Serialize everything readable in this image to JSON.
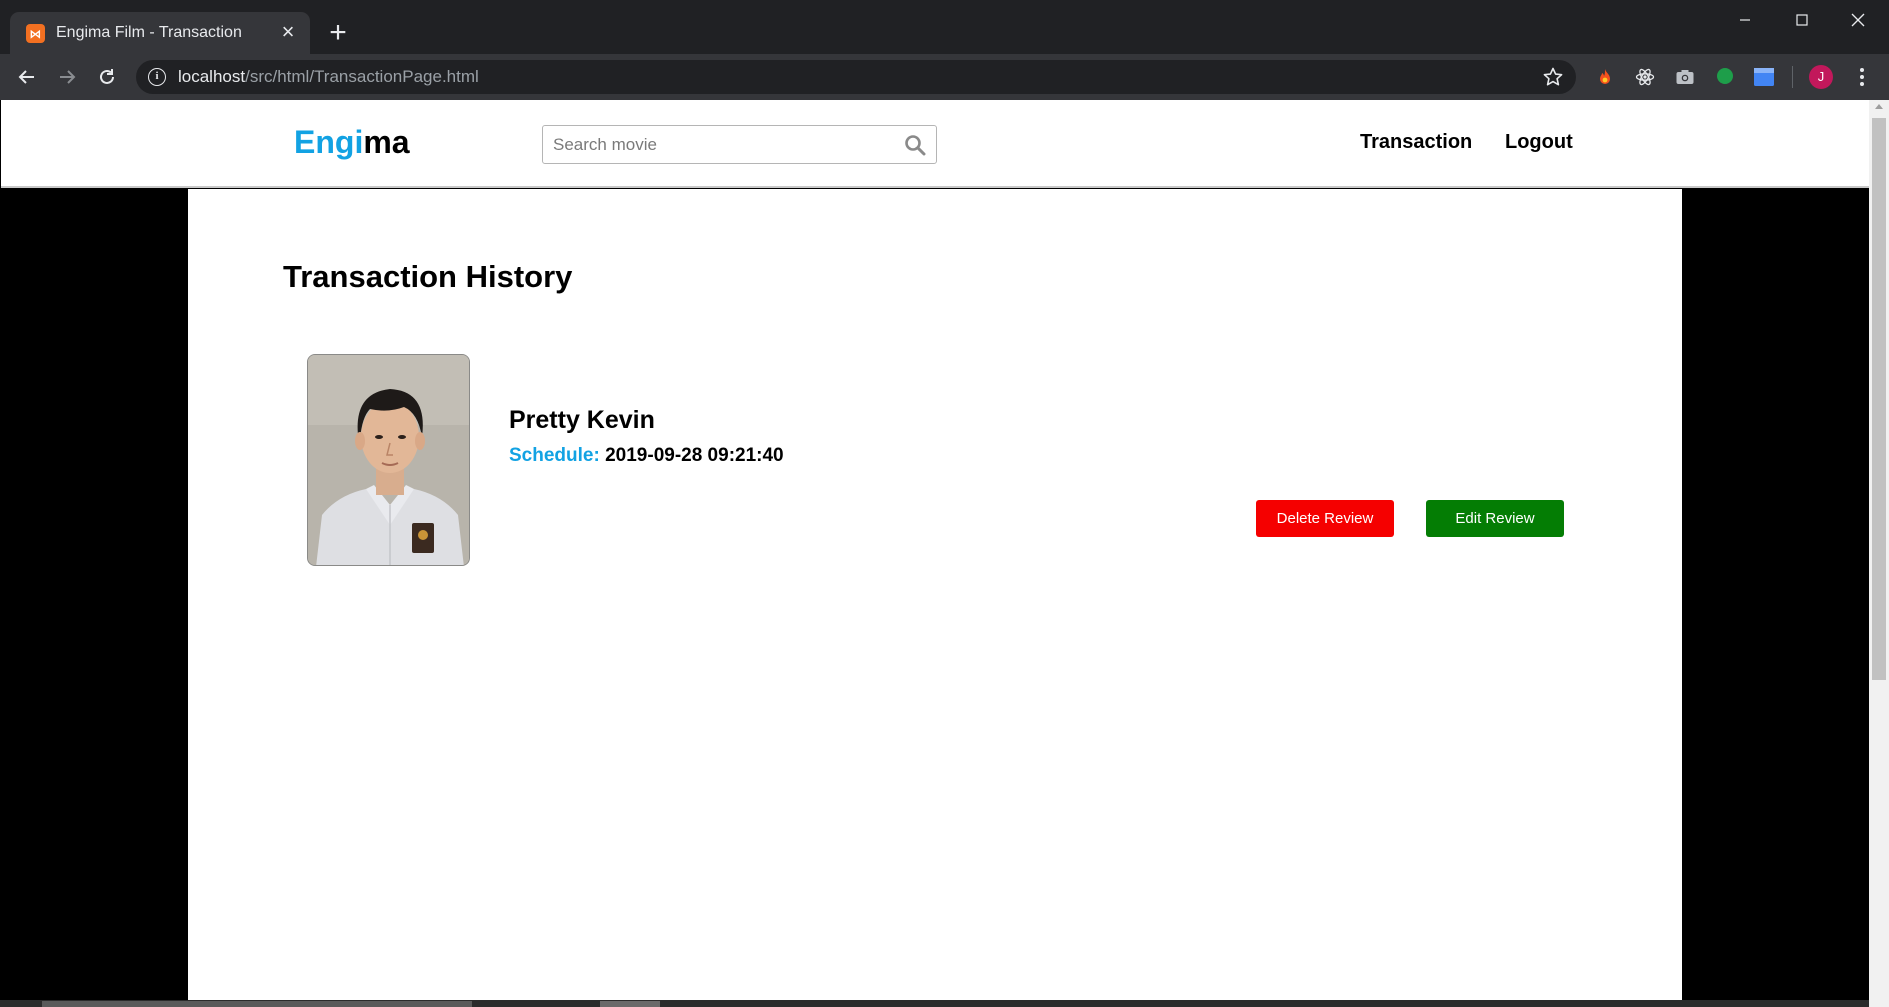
{
  "browser": {
    "tab_title": "Engima Film - Transaction",
    "tab_favicon": "xampp-favicon-icon",
    "url_host": "localhost",
    "url_path": "/src/html/TransactionPage.html",
    "profile_initial": "J",
    "extensions": [
      "fire-extension-icon",
      "react-extension-icon",
      "camera-extension-icon",
      "green-circle-extension-icon",
      "window-extension-icon"
    ]
  },
  "navbar": {
    "logo_part1": "Engi",
    "logo_part2": "ma",
    "search_placeholder": "Search movie",
    "search_value": "",
    "links": {
      "transaction": "Transaction",
      "logout": "Logout"
    }
  },
  "page": {
    "title": "Transaction History"
  },
  "transactions": [
    {
      "movie_title": "Pretty Kevin",
      "schedule_label": "Schedule:",
      "schedule_value": "2019-09-28 09:21:40",
      "delete_label": "Delete Review",
      "edit_label": "Edit Review"
    }
  ],
  "colors": {
    "accent": "#12a2e3",
    "delete": "#f50000",
    "edit": "#047d04",
    "chrome_dark": "#202124",
    "chrome_toolbar": "#35363a"
  }
}
